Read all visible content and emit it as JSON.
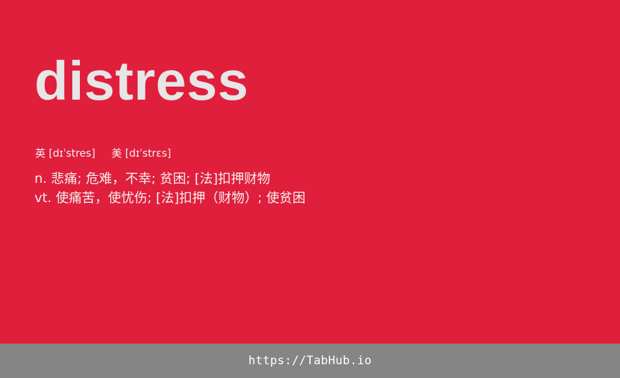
{
  "word": "distress",
  "phonetics": {
    "uk_label": "英",
    "uk_ipa": "[dɪˈstres]",
    "us_label": "美",
    "us_ipa": "[dɪˈstrɛs]"
  },
  "definitions": [
    {
      "pos": "n.",
      "text": "悲痛; 危难，不幸; 贫困; [法]扣押财物"
    },
    {
      "pos": "vt.",
      "text": "使痛苦，使忧伤; [法]扣押（财物）; 使贫困"
    }
  ],
  "footer": {
    "url": "https://TabHub.io"
  },
  "colors": {
    "background": "#e01f3d",
    "word": "#e6e6e6",
    "footer_bg": "#858585"
  }
}
